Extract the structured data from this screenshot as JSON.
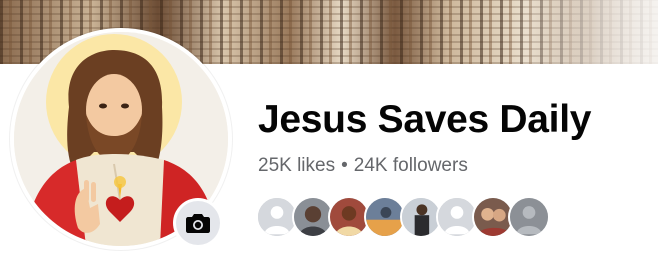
{
  "page": {
    "title": "Jesus Saves Daily",
    "likes": "25K likes",
    "separator": "•",
    "followers": "24K followers"
  },
  "profile": {
    "avatar_icon": "profile-picture",
    "camera_icon": "camera-icon"
  },
  "follower_facepile": [
    {
      "type": "default-avatar"
    },
    {
      "type": "photo"
    },
    {
      "type": "photo"
    },
    {
      "type": "photo"
    },
    {
      "type": "photo"
    },
    {
      "type": "default-avatar"
    },
    {
      "type": "photo"
    },
    {
      "type": "default-avatar-dark"
    }
  ],
  "colors": {
    "title": "#050505",
    "secondary_text": "#65676b",
    "camera_button_bg": "#e4e6eb"
  }
}
